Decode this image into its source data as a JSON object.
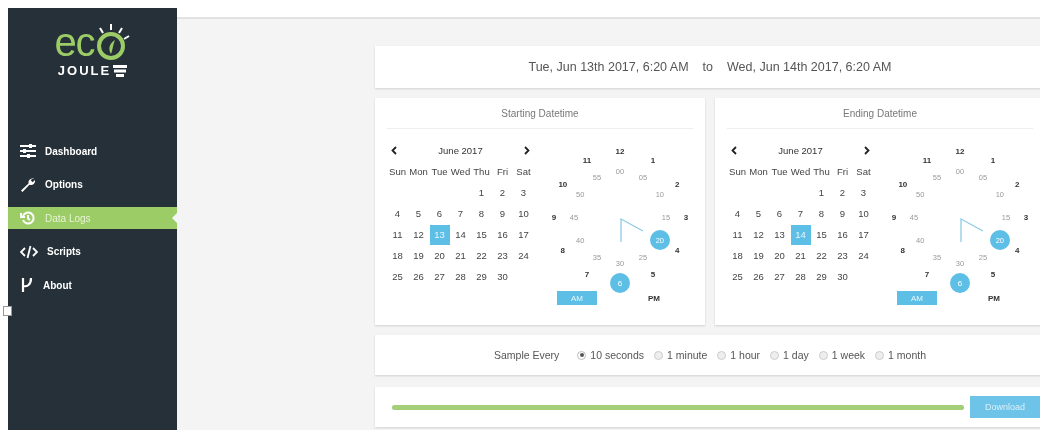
{
  "sidebar": {
    "logo": {
      "top": "ec",
      "bottom": "JOULE"
    },
    "items": [
      {
        "label": "Dashboard",
        "kind": "sliders",
        "selected": false
      },
      {
        "label": "Options",
        "kind": "wrench",
        "selected": false
      },
      {
        "label": "Data Logs",
        "kind": "history",
        "selected": true
      },
      {
        "label": "Scripts",
        "kind": "code",
        "selected": false
      },
      {
        "label": "About",
        "kind": "mu",
        "selected": false
      }
    ]
  },
  "range": {
    "start": "Tue, Jun 13th 2017, 6:20 AM",
    "separator": "to",
    "end": "Wed, Jun 14th 2017, 6:20 AM"
  },
  "pickers": [
    {
      "title": "Starting Datetime",
      "month": "June 2017",
      "weekdays": [
        "Sun",
        "Mon",
        "Tue",
        "Wed",
        "Thu",
        "Fri",
        "Sat"
      ],
      "weeks": [
        [
          {
            "label": "1",
            "selected": false
          },
          {
            "label": "2",
            "selected": false
          },
          {
            "label": "3",
            "selected": false
          }
        ],
        [
          {
            "label": "4",
            "selected": false
          },
          {
            "label": "5",
            "selected": false
          },
          {
            "label": "6",
            "selected": false
          },
          {
            "label": "7",
            "selected": false
          },
          {
            "label": "8",
            "selected": false
          },
          {
            "label": "9",
            "selected": false
          },
          {
            "label": "10",
            "selected": false
          }
        ],
        [
          {
            "label": "11",
            "selected": false
          },
          {
            "label": "12",
            "selected": false
          },
          {
            "label": "13",
            "selected": true
          },
          {
            "label": "14",
            "selected": false
          },
          {
            "label": "15",
            "selected": false
          },
          {
            "label": "16",
            "selected": false
          },
          {
            "label": "17",
            "selected": false
          }
        ],
        [
          {
            "label": "18",
            "selected": false
          },
          {
            "label": "19",
            "selected": false
          },
          {
            "label": "20",
            "selected": false
          },
          {
            "label": "21",
            "selected": false
          },
          {
            "label": "22",
            "selected": false
          },
          {
            "label": "23",
            "selected": false
          },
          {
            "label": "24",
            "selected": false
          }
        ],
        [
          {
            "label": "25",
            "selected": false
          },
          {
            "label": "26",
            "selected": false
          },
          {
            "label": "27",
            "selected": false
          },
          {
            "label": "28",
            "selected": false
          },
          {
            "label": "29",
            "selected": false
          },
          {
            "label": "30",
            "selected": false
          }
        ]
      ],
      "hours": [
        {
          "label": "12",
          "selected": false
        },
        {
          "label": "1",
          "selected": false
        },
        {
          "label": "2",
          "selected": false
        },
        {
          "label": "3",
          "selected": false
        },
        {
          "label": "4",
          "selected": false
        },
        {
          "label": "5",
          "selected": false
        },
        {
          "label": "6",
          "selected": true
        },
        {
          "label": "7",
          "selected": false
        },
        {
          "label": "8",
          "selected": false
        },
        {
          "label": "9",
          "selected": false
        },
        {
          "label": "10",
          "selected": false
        },
        {
          "label": "11",
          "selected": false
        }
      ],
      "minutes": [
        {
          "label": "00",
          "selected": false
        },
        {
          "label": "05",
          "selected": false
        },
        {
          "label": "10",
          "selected": false
        },
        {
          "label": "15",
          "selected": false
        },
        {
          "label": "20",
          "selected": true
        },
        {
          "label": "25",
          "selected": false
        },
        {
          "label": "30",
          "selected": false
        },
        {
          "label": "35",
          "selected": false
        },
        {
          "label": "40",
          "selected": false
        },
        {
          "label": "45",
          "selected": false
        },
        {
          "label": "50",
          "selected": false
        },
        {
          "label": "55",
          "selected": false
        }
      ],
      "meridiem": [
        {
          "label": "AM",
          "selected": true
        },
        {
          "label": "PM",
          "selected": false
        }
      ]
    },
    {
      "title": "Ending Datetime",
      "month": "June 2017",
      "weekdays": [
        "Sun",
        "Mon",
        "Tue",
        "Wed",
        "Thu",
        "Fri",
        "Sat"
      ],
      "weeks": [
        [
          {
            "label": "1",
            "selected": false
          },
          {
            "label": "2",
            "selected": false
          },
          {
            "label": "3",
            "selected": false
          }
        ],
        [
          {
            "label": "4",
            "selected": false
          },
          {
            "label": "5",
            "selected": false
          },
          {
            "label": "6",
            "selected": false
          },
          {
            "label": "7",
            "selected": false
          },
          {
            "label": "8",
            "selected": false
          },
          {
            "label": "9",
            "selected": false
          },
          {
            "label": "10",
            "selected": false
          }
        ],
        [
          {
            "label": "11",
            "selected": false
          },
          {
            "label": "12",
            "selected": false
          },
          {
            "label": "13",
            "selected": false
          },
          {
            "label": "14",
            "selected": true
          },
          {
            "label": "15",
            "selected": false
          },
          {
            "label": "16",
            "selected": false
          },
          {
            "label": "17",
            "selected": false
          }
        ],
        [
          {
            "label": "18",
            "selected": false
          },
          {
            "label": "19",
            "selected": false
          },
          {
            "label": "20",
            "selected": false
          },
          {
            "label": "21",
            "selected": false
          },
          {
            "label": "22",
            "selected": false
          },
          {
            "label": "23",
            "selected": false
          },
          {
            "label": "24",
            "selected": false
          }
        ],
        [
          {
            "label": "25",
            "selected": false
          },
          {
            "label": "26",
            "selected": false
          },
          {
            "label": "27",
            "selected": false
          },
          {
            "label": "28",
            "selected": false
          },
          {
            "label": "29",
            "selected": false
          },
          {
            "label": "30",
            "selected": false
          }
        ]
      ],
      "hours": [
        {
          "label": "12",
          "selected": false
        },
        {
          "label": "1",
          "selected": false
        },
        {
          "label": "2",
          "selected": false
        },
        {
          "label": "3",
          "selected": false
        },
        {
          "label": "4",
          "selected": false
        },
        {
          "label": "5",
          "selected": false
        },
        {
          "label": "6",
          "selected": true
        },
        {
          "label": "7",
          "selected": false
        },
        {
          "label": "8",
          "selected": false
        },
        {
          "label": "9",
          "selected": false
        },
        {
          "label": "10",
          "selected": false
        },
        {
          "label": "11",
          "selected": false
        }
      ],
      "minutes": [
        {
          "label": "00",
          "selected": false
        },
        {
          "label": "05",
          "selected": false
        },
        {
          "label": "10",
          "selected": false
        },
        {
          "label": "15",
          "selected": false
        },
        {
          "label": "20",
          "selected": true
        },
        {
          "label": "25",
          "selected": false
        },
        {
          "label": "30",
          "selected": false
        },
        {
          "label": "35",
          "selected": false
        },
        {
          "label": "40",
          "selected": false
        },
        {
          "label": "45",
          "selected": false
        },
        {
          "label": "50",
          "selected": false
        },
        {
          "label": "55",
          "selected": false
        }
      ],
      "meridiem": [
        {
          "label": "AM",
          "selected": true
        },
        {
          "label": "PM",
          "selected": false
        }
      ]
    }
  ],
  "sample": {
    "label": "Sample Every",
    "options": [
      {
        "label": "10 seconds",
        "selected": true
      },
      {
        "label": "1 minute",
        "selected": false
      },
      {
        "label": "1 hour",
        "selected": false
      },
      {
        "label": "1 day",
        "selected": false
      },
      {
        "label": "1 week",
        "selected": false
      },
      {
        "label": "1 month",
        "selected": false
      }
    ]
  },
  "download": {
    "level": 1,
    "button": "Download"
  }
}
